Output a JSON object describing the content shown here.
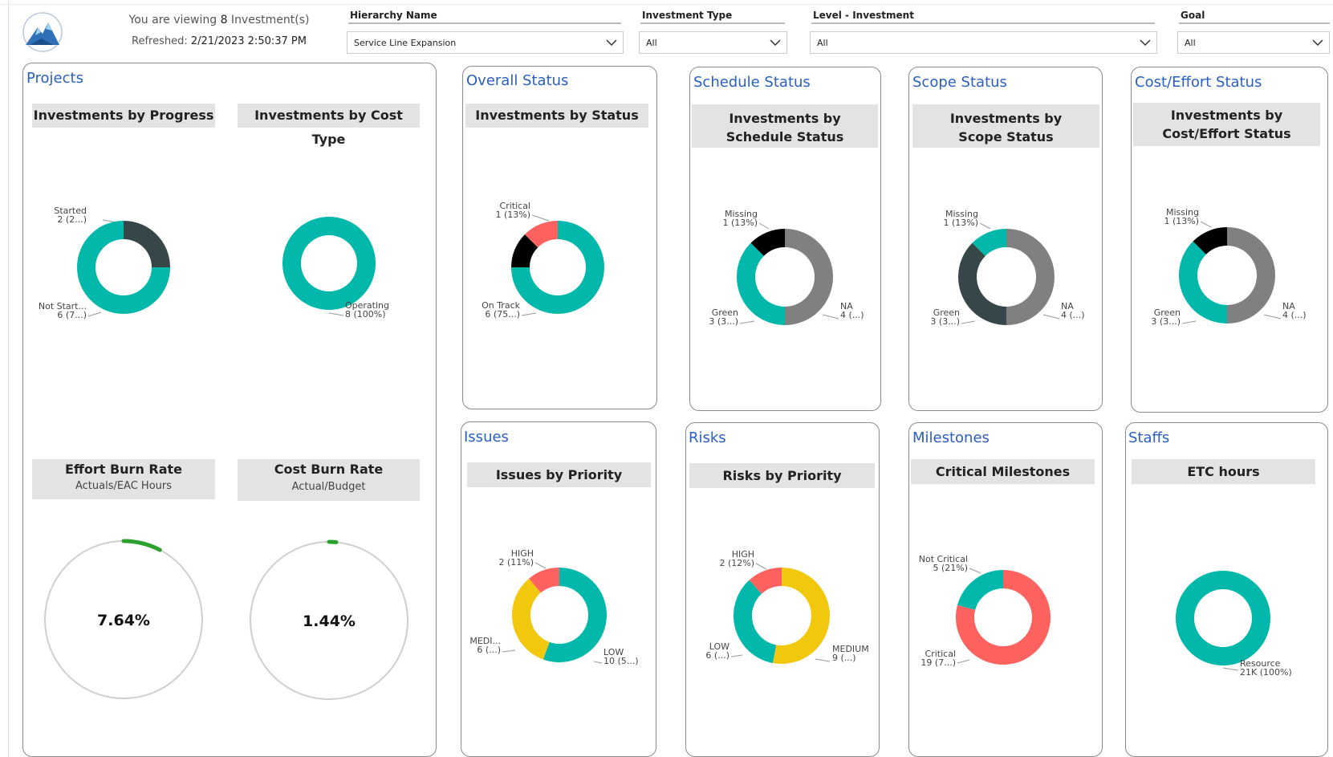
{
  "header": {
    "viewing_prefix": "You are viewing ",
    "viewing_count": "8",
    "viewing_suffix": " Investment(s)",
    "refreshed_label": "Refreshed: ",
    "refreshed_value": "2/21/2023 2:50:37 PM",
    "logo_icon": "mountain-logo-icon"
  },
  "filters": [
    {
      "label": "Hierarchy Name",
      "value": "Service Line Expansion"
    },
    {
      "label": "Investment Type",
      "value": "All"
    },
    {
      "label": "Level - Investment",
      "value": "All"
    },
    {
      "label": "Goal",
      "value": "All"
    }
  ],
  "colors": {
    "teal": "#01B8AA",
    "dark": "#374649",
    "red": "#FD625E",
    "black": "#000000",
    "gray": "#808080",
    "yellow": "#F2C80F",
    "green_arc": "#2CA02C",
    "card_title": "#2a5fbf"
  },
  "sections": {
    "projects": "Projects",
    "overall": "Overall Status",
    "schedule": "Schedule Status",
    "scope": "Scope Status",
    "cost": "Cost/Effort Status",
    "issues": "Issues",
    "risks": "Risks",
    "milestones": "Milestones",
    "staffs": "Staffs"
  },
  "visuals": {
    "progress": "Investments by Progress",
    "cost_type": "Investments by Cost Type",
    "by_status": "Investments by Status",
    "by_schedule": "Investments by Schedule Status",
    "by_scope": "Investments by Scope Status",
    "by_cost_effort": "Investments by Cost/Effort Status",
    "effort_burn": "Effort Burn Rate",
    "effort_burn_sub": "Actuals/EAC Hours",
    "cost_burn": "Cost Burn Rate",
    "cost_burn_sub": "Actual/Budget",
    "issues_priority": "Issues by Priority",
    "risks_priority": "Risks by Priority",
    "critical_milestones": "Critical Milestones",
    "etc_hours": "ETC hours"
  },
  "gauges": {
    "effort": {
      "value": 7.64,
      "label": "7.64%"
    },
    "cost": {
      "value": 1.44,
      "label": "1.44%"
    }
  },
  "chart_data": [
    {
      "id": "progress",
      "type": "pie",
      "values": [
        2,
        6
      ],
      "slices": [
        {
          "l1": "Started",
          "l2": "2 (2...)",
          "color": "dark"
        },
        {
          "l1": "Not Start...",
          "l2": "6 (7...)",
          "color": "teal"
        }
      ]
    },
    {
      "id": "cost_type",
      "type": "pie",
      "values": [
        8
      ],
      "slices": [
        {
          "l1": "Operating",
          "l2": "8 (100%)",
          "color": "teal"
        }
      ]
    },
    {
      "id": "status",
      "type": "pie",
      "values": [
        6,
        1,
        1
      ],
      "slices": [
        {
          "l1": "On Track",
          "l2": "6 (75...)",
          "color": "teal"
        },
        {
          "l1": "",
          "l2": "",
          "color": "black"
        },
        {
          "l1": "Critical",
          "l2": "1 (13%)",
          "color": "red"
        }
      ]
    },
    {
      "id": "schedule",
      "type": "pie",
      "values": [
        4,
        3,
        1
      ],
      "slices": [
        {
          "l1": "NA",
          "l2": "4 (...)",
          "color": "gray"
        },
        {
          "l1": "Green",
          "l2": "3 (3...)",
          "color": "teal"
        },
        {
          "l1": "Missing",
          "l2": "1 (13%)",
          "color": "black"
        }
      ]
    },
    {
      "id": "scope",
      "type": "pie",
      "values": [
        4,
        3,
        1
      ],
      "slices": [
        {
          "l1": "NA",
          "l2": "4 (...)",
          "color": "gray"
        },
        {
          "l1": "Green",
          "l2": "3 (3...)",
          "color": "dark"
        },
        {
          "l1": "Missing",
          "l2": "1 (13%)",
          "color": "teal"
        }
      ]
    },
    {
      "id": "cost_effort",
      "type": "pie",
      "values": [
        4,
        3,
        1
      ],
      "slices": [
        {
          "l1": "NA",
          "l2": "4 (...)",
          "color": "gray"
        },
        {
          "l1": "Green",
          "l2": "3 (3...)",
          "color": "teal"
        },
        {
          "l1": "Missing",
          "l2": "1 (13%)",
          "color": "black"
        }
      ]
    },
    {
      "id": "issues",
      "type": "pie",
      "values": [
        10,
        6,
        2
      ],
      "slices": [
        {
          "l1": "LOW",
          "l2": "10 (5...)",
          "color": "teal"
        },
        {
          "l1": "MEDI...",
          "l2": "6 (...)",
          "color": "yellow"
        },
        {
          "l1": "HIGH",
          "l2": "2 (11%)",
          "color": "red"
        }
      ]
    },
    {
      "id": "risks",
      "type": "pie",
      "values": [
        9,
        6,
        2
      ],
      "slices": [
        {
          "l1": "MEDIUM",
          "l2": "9 (...)",
          "color": "yellow"
        },
        {
          "l1": "LOW",
          "l2": "6 (...)",
          "color": "teal"
        },
        {
          "l1": "HIGH",
          "l2": "2 (12%)",
          "color": "red"
        }
      ]
    },
    {
      "id": "milestones",
      "type": "pie",
      "values": [
        19,
        5
      ],
      "slices": [
        {
          "l1": "Critical",
          "l2": "19 (7...)",
          "color": "red"
        },
        {
          "l1": "Not Critical",
          "l2": "5 (21%)",
          "color": "teal"
        }
      ]
    },
    {
      "id": "staffs",
      "type": "pie",
      "values": [
        21000
      ],
      "slices": [
        {
          "l1": "Resource",
          "l2": "21K (100%)",
          "color": "teal"
        }
      ]
    }
  ]
}
